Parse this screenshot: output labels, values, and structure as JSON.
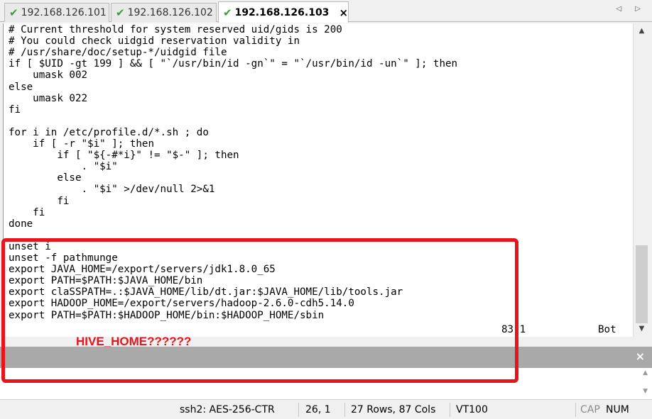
{
  "tabs": [
    {
      "label": "192.168.126.101",
      "active": false
    },
    {
      "label": "192.168.126.102",
      "active": false
    },
    {
      "label": "192.168.126.103",
      "active": true
    }
  ],
  "tab_close_symbol": "×",
  "tab_nav_symbols": "◁ ▷",
  "terminal": {
    "lines": [
      "# Current threshold for system reserved uid/gids is 200",
      "# You could check uidgid reservation validity in",
      "# /usr/share/doc/setup-*/uidgid file",
      "if [ $UID -gt 199 ] && [ \"`/usr/bin/id -gn`\" = \"`/usr/bin/id -un`\" ]; then",
      "    umask 002",
      "else",
      "    umask 022",
      "fi",
      "",
      "for i in /etc/profile.d/*.sh ; do",
      "    if [ -r \"$i\" ]; then",
      "        if [ \"${-#*i}\" != \"$-\" ]; then",
      "            . \"$i\"",
      "        else",
      "            . \"$i\" >/dev/null 2>&1",
      "        fi",
      "    fi",
      "done",
      "",
      "unset i",
      "unset -f pathmunge",
      "export JAVA_HOME=/export/servers/jdk1.8.0_65",
      "export PATH=$PATH:$JAVA_HOME/bin",
      "export claSSPATH=.:$JAVA_HOME/lib/dt.jar:$JAVA_HOME/lib/tools.jar",
      "export HADOOP_HOME=/export/servers/hadoop-2.6.0-cdh5.14.0",
      "export PATH=$PATH:$HADOOP_HOME/bin:$HADOOP_HOME/sbin"
    ],
    "status_position": "83,1",
    "status_scroll": "Bot"
  },
  "command_window": {
    "close_symbol": "×"
  },
  "statusbar": {
    "cipher": "ssh2: AES-256-CTR",
    "cursor": "26,  1",
    "size": "27 Rows, 87 Cols",
    "emulation": "VT100",
    "cap": "CAP",
    "num": "NUM"
  },
  "annotation": {
    "text": "HIVE_HOME??????",
    "color": "#e8141c"
  },
  "colors": {
    "accent_check": "#3a9c3a",
    "annotation": "#e8141c"
  }
}
